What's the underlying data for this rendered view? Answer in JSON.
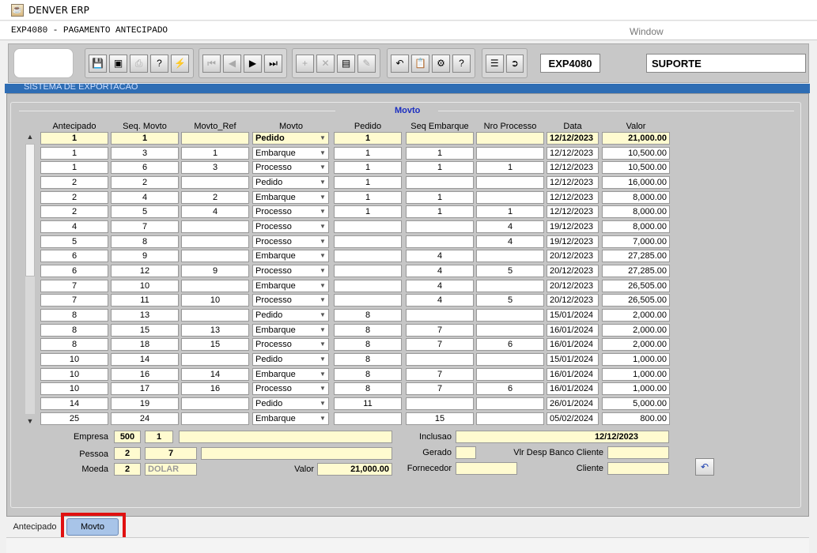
{
  "window": {
    "title": "DENVER ERP",
    "form_title": "EXP4080 - PAGAMENTO ANTECIPADO",
    "window_menu": "Window"
  },
  "toolbar": {
    "form_code": "EXP4080",
    "user": "SUPORTE",
    "system_band": "SISTEMA DE EXPORTACAO"
  },
  "section": {
    "title": "Movto"
  },
  "columns": {
    "antecipado": "Antecipado",
    "seq_movto": "Seq. Movto",
    "movto_ref": "Movto_Ref",
    "movto": "Movto",
    "pedido": "Pedido",
    "seq_embarque": "Seq Embarque",
    "nro_processo": "Nro Processo",
    "data": "Data",
    "valor": "Valor"
  },
  "rows": [
    {
      "antecipado": "1",
      "seq_movto": "1",
      "movto_ref": "",
      "movto": "Pedido",
      "pedido": "1",
      "seq_embarque": "",
      "nro_processo": "",
      "data": "12/12/2023",
      "valor": "21,000.00"
    },
    {
      "antecipado": "1",
      "seq_movto": "3",
      "movto_ref": "1",
      "movto": "Embarque",
      "pedido": "1",
      "seq_embarque": "1",
      "nro_processo": "",
      "data": "12/12/2023",
      "valor": "10,500.00"
    },
    {
      "antecipado": "1",
      "seq_movto": "6",
      "movto_ref": "3",
      "movto": "Processo",
      "pedido": "1",
      "seq_embarque": "1",
      "nro_processo": "1",
      "data": "12/12/2023",
      "valor": "10,500.00"
    },
    {
      "antecipado": "2",
      "seq_movto": "2",
      "movto_ref": "",
      "movto": "Pedido",
      "pedido": "1",
      "seq_embarque": "",
      "nro_processo": "",
      "data": "12/12/2023",
      "valor": "16,000.00"
    },
    {
      "antecipado": "2",
      "seq_movto": "4",
      "movto_ref": "2",
      "movto": "Embarque",
      "pedido": "1",
      "seq_embarque": "1",
      "nro_processo": "",
      "data": "12/12/2023",
      "valor": "8,000.00"
    },
    {
      "antecipado": "2",
      "seq_movto": "5",
      "movto_ref": "4",
      "movto": "Processo",
      "pedido": "1",
      "seq_embarque": "1",
      "nro_processo": "1",
      "data": "12/12/2023",
      "valor": "8,000.00"
    },
    {
      "antecipado": "4",
      "seq_movto": "7",
      "movto_ref": "",
      "movto": "Processo",
      "pedido": "",
      "seq_embarque": "",
      "nro_processo": "4",
      "data": "19/12/2023",
      "valor": "8,000.00"
    },
    {
      "antecipado": "5",
      "seq_movto": "8",
      "movto_ref": "",
      "movto": "Processo",
      "pedido": "",
      "seq_embarque": "",
      "nro_processo": "4",
      "data": "19/12/2023",
      "valor": "7,000.00"
    },
    {
      "antecipado": "6",
      "seq_movto": "9",
      "movto_ref": "",
      "movto": "Embarque",
      "pedido": "",
      "seq_embarque": "4",
      "nro_processo": "",
      "data": "20/12/2023",
      "valor": "27,285.00"
    },
    {
      "antecipado": "6",
      "seq_movto": "12",
      "movto_ref": "9",
      "movto": "Processo",
      "pedido": "",
      "seq_embarque": "4",
      "nro_processo": "5",
      "data": "20/12/2023",
      "valor": "27,285.00"
    },
    {
      "antecipado": "7",
      "seq_movto": "10",
      "movto_ref": "",
      "movto": "Embarque",
      "pedido": "",
      "seq_embarque": "4",
      "nro_processo": "",
      "data": "20/12/2023",
      "valor": "26,505.00"
    },
    {
      "antecipado": "7",
      "seq_movto": "11",
      "movto_ref": "10",
      "movto": "Processo",
      "pedido": "",
      "seq_embarque": "4",
      "nro_processo": "5",
      "data": "20/12/2023",
      "valor": "26,505.00"
    },
    {
      "antecipado": "8",
      "seq_movto": "13",
      "movto_ref": "",
      "movto": "Pedido",
      "pedido": "8",
      "seq_embarque": "",
      "nro_processo": "",
      "data": "15/01/2024",
      "valor": "2,000.00"
    },
    {
      "antecipado": "8",
      "seq_movto": "15",
      "movto_ref": "13",
      "movto": "Embarque",
      "pedido": "8",
      "seq_embarque": "7",
      "nro_processo": "",
      "data": "16/01/2024",
      "valor": "2,000.00"
    },
    {
      "antecipado": "8",
      "seq_movto": "18",
      "movto_ref": "15",
      "movto": "Processo",
      "pedido": "8",
      "seq_embarque": "7",
      "nro_processo": "6",
      "data": "16/01/2024",
      "valor": "2,000.00"
    },
    {
      "antecipado": "10",
      "seq_movto": "14",
      "movto_ref": "",
      "movto": "Pedido",
      "pedido": "8",
      "seq_embarque": "",
      "nro_processo": "",
      "data": "15/01/2024",
      "valor": "1,000.00"
    },
    {
      "antecipado": "10",
      "seq_movto": "16",
      "movto_ref": "14",
      "movto": "Embarque",
      "pedido": "8",
      "seq_embarque": "7",
      "nro_processo": "",
      "data": "16/01/2024",
      "valor": "1,000.00"
    },
    {
      "antecipado": "10",
      "seq_movto": "17",
      "movto_ref": "16",
      "movto": "Processo",
      "pedido": "8",
      "seq_embarque": "7",
      "nro_processo": "6",
      "data": "16/01/2024",
      "valor": "1,000.00"
    },
    {
      "antecipado": "14",
      "seq_movto": "19",
      "movto_ref": "",
      "movto": "Pedido",
      "pedido": "11",
      "seq_embarque": "",
      "nro_processo": "",
      "data": "26/01/2024",
      "valor": "5,000.00"
    },
    {
      "antecipado": "25",
      "seq_movto": "24",
      "movto_ref": "",
      "movto": "Embarque",
      "pedido": "",
      "seq_embarque": "15",
      "nro_processo": "",
      "data": "05/02/2024",
      "valor": "800.00"
    }
  ],
  "details": {
    "empresa_label": "Empresa",
    "empresa_code": "500",
    "empresa_sub": "1",
    "empresa_name": "",
    "pessoa_label": "Pessoa",
    "pessoa_code": "2",
    "pessoa_sub": "7",
    "pessoa_name": "",
    "moeda_label": "Moeda",
    "moeda_code": "2",
    "moeda_name": "DOLAR",
    "valor_label": "Valor",
    "valor": "21,000.00",
    "inclusao_label": "Inclusao",
    "inclusao": "12/12/2023",
    "gerado_label": "Gerado",
    "gerado": "",
    "vlr_desp_label": "Vlr Desp Banco Cliente",
    "vlr_desp": "",
    "fornecedor_label": "Fornecedor",
    "fornecedor": "",
    "cliente_label": "Cliente",
    "cliente": ""
  },
  "tabs": [
    {
      "label": "Antecipado",
      "active": false
    },
    {
      "label": "Movto",
      "active": true
    }
  ],
  "colors": {
    "accent_band": "#2e6db4",
    "section_title": "#1c2fc0",
    "yellow_field": "#fffbd0",
    "active_tab": "#a8c4e8",
    "highlight": "#e01010"
  }
}
